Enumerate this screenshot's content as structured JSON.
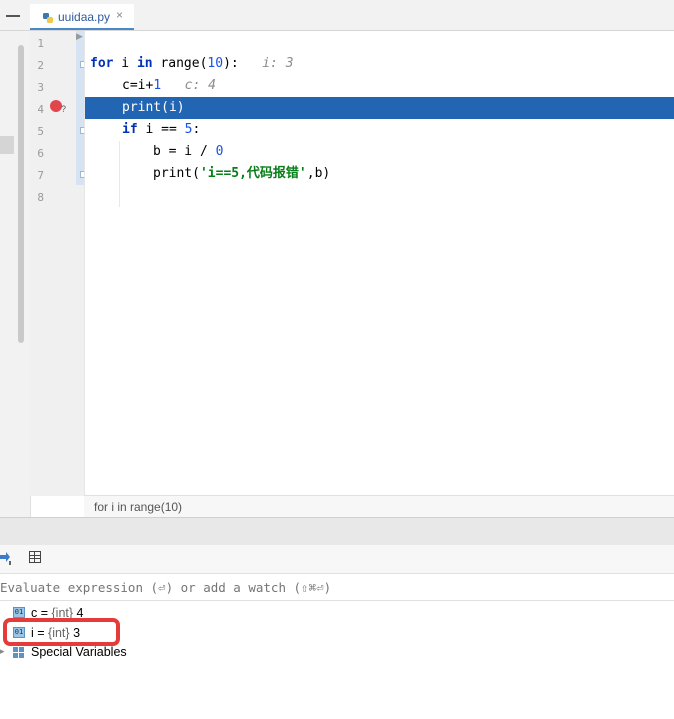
{
  "tab": {
    "filename": "uuidaa.py",
    "close_glyph": "×"
  },
  "gutter": {
    "line_numbers": [
      "1",
      "2",
      "3",
      "4",
      "5",
      "6",
      "7",
      "8"
    ]
  },
  "code": {
    "l2": {
      "kw_for": "for",
      "var": " i ",
      "kw_in": "in",
      "call": " range(",
      "num": "10",
      "close": "):",
      "inline": "i: 3"
    },
    "l3": {
      "text": "c=i+",
      "num": "1",
      "inline": "c: 4"
    },
    "l4": {
      "text": "print(i)"
    },
    "l5": {
      "kw_if": "if",
      "text": " i == ",
      "num": "5",
      "colon": ":"
    },
    "l6": {
      "text": "b = i / ",
      "num": "0"
    },
    "l7": {
      "call": "print(",
      "str": "'i==5,代码报错'",
      "rest": ",b)"
    }
  },
  "breadcrumb": "for i in range(10)",
  "debugger": {
    "eval_placeholder": "Evaluate expression (⏎) or add a watch (⇧⌘⏎)",
    "vars": [
      {
        "name": "c",
        "eq": " = ",
        "type": "{int}",
        "value": " 4"
      },
      {
        "name": "i",
        "eq": " = ",
        "type": "{int}",
        "value": " 3"
      }
    ],
    "special_label": "Special Variables",
    "var_icon_text": "01"
  },
  "colors": {
    "execution_line": "#2266b3",
    "highlight": "#e63b3b",
    "breakpoint": "#e0474c"
  },
  "icons": [
    "python-file-icon",
    "close-icon",
    "breakpoint-icon",
    "step-icon",
    "table-icon",
    "variable-icon",
    "special-variables-icon"
  ]
}
